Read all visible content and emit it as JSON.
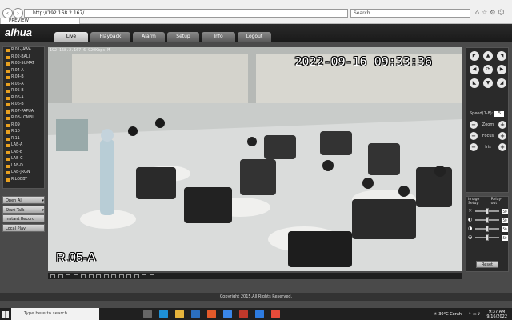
{
  "browser": {
    "address": "http://192.168.2.167/",
    "search_placeholder": "Search...",
    "tab_title": "PREVIEW"
  },
  "app": {
    "logo": "alhua",
    "menu": [
      {
        "label": "Live",
        "active": true
      },
      {
        "label": "Playback",
        "active": false
      },
      {
        "label": "Alarm",
        "active": false
      },
      {
        "label": "Setup",
        "active": false
      },
      {
        "label": "Info",
        "active": false
      },
      {
        "label": "Logout",
        "active": false
      }
    ]
  },
  "channels": [
    "R.01-JAWA",
    "R.02-BALI",
    "R.03-SUMAT",
    "R.04-A",
    "R.04-B",
    "R.05-A",
    "R.05-B",
    "R.06-A",
    "R.06-B",
    "R.07-PAPUA",
    "R.08-LOMBI",
    "R.09",
    "R.10",
    "R.11",
    "LAB-A",
    "LAB-B",
    "LAB-C",
    "LAB-D",
    "LAB-JRGN",
    "R.LOBBY"
  ],
  "left_buttons": [
    {
      "label": "Open All",
      "icon": "open-icon"
    },
    {
      "label": "Start Talk",
      "icon": "phone-icon"
    },
    {
      "label": "Instant Record",
      "icon": "record-icon"
    },
    {
      "label": "Local Play",
      "icon": "play-icon"
    }
  ],
  "video": {
    "info": "192.168.2.167-6  920Kbps  M",
    "timestamp": "2022-09-16  09:33:36",
    "room_label": "R.05-A"
  },
  "ptz": {
    "speed_label": "Speed(1-8):",
    "speed_value": "5",
    "zoom": "Zoom",
    "focus": "Focus",
    "iris": "Iris"
  },
  "image_setup": {
    "tab1": "Image Setup",
    "tab2": "Relay-out",
    "sliders": [
      {
        "icon": "brightness-icon",
        "value": "50",
        "level": 0.5
      },
      {
        "icon": "contrast-icon",
        "value": "50",
        "level": 0.5
      },
      {
        "icon": "saturation-icon",
        "value": "50",
        "level": 0.5
      },
      {
        "icon": "hue-icon",
        "value": "50",
        "level": 0.5
      }
    ],
    "reset": "Reset"
  },
  "footer": "Copyright 2015,All Rights Reserved.",
  "taskbar": {
    "search_placeholder": "Type here to search",
    "weather": "30°C  Cerah",
    "time": "9:37 AM",
    "date": "9/16/2022"
  }
}
